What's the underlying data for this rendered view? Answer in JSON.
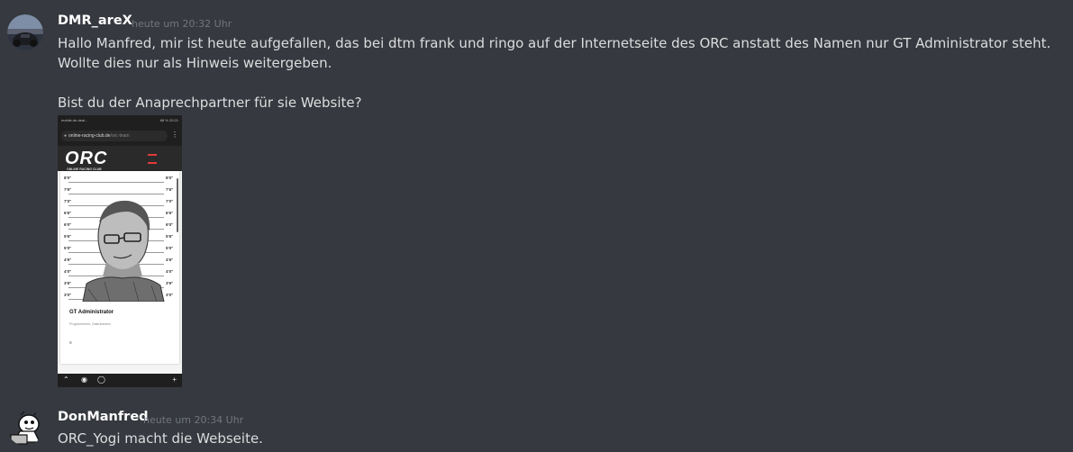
{
  "messages": [
    {
      "username": "DMR_areX",
      "timestamp": "heute um 20:32 Uhr",
      "text": "Hallo Manfred, mir ist heute aufgefallen, das bei dtm frank und ringo auf der Internetseite des ORC anstatt des Namen nur GT Administrator steht. Wollte dies nur als Hinweis weitergeben.\n\nBist du der Anaprechpartner für sie Website?",
      "avatar_icon": "racing-car-avatar"
    },
    {
      "username": "DonManfred",
      "timestamp": "heute um 20:34 Uhr",
      "text": "ORC_Yogi macht die Webseite.",
      "avatar_icon": "cartoon-laptop-avatar"
    }
  ],
  "attachment": {
    "status_left": "mobile.de.deal...",
    "status_right": "88 % 20:21",
    "url_domain": "online-racing-club.de",
    "url_path": "/orc-team",
    "logo": "ORC",
    "logo_sub": "ONLINE RACING CLUB",
    "height_labels": [
      "8'0\"",
      "7'6\"",
      "7'0\"",
      "6'6\"",
      "6'0\"",
      "5'6\"",
      "5'0\"",
      "4'6\"",
      "4'0\"",
      "3'6\"",
      "3'0\""
    ],
    "caption": "GT Administrator",
    "role": "Programmierer, Datenbanken",
    "icons": [
      "lock-icon",
      "tabs-icon",
      "more-icon",
      "hamburger-menu-icon",
      "back-icon",
      "home-icon",
      "add-icon"
    ]
  },
  "colors": {
    "background": "#36393f",
    "username": "#ffffff",
    "timestamp": "#72767d",
    "text": "#dcddde",
    "brand_red": "#e23a3a"
  }
}
